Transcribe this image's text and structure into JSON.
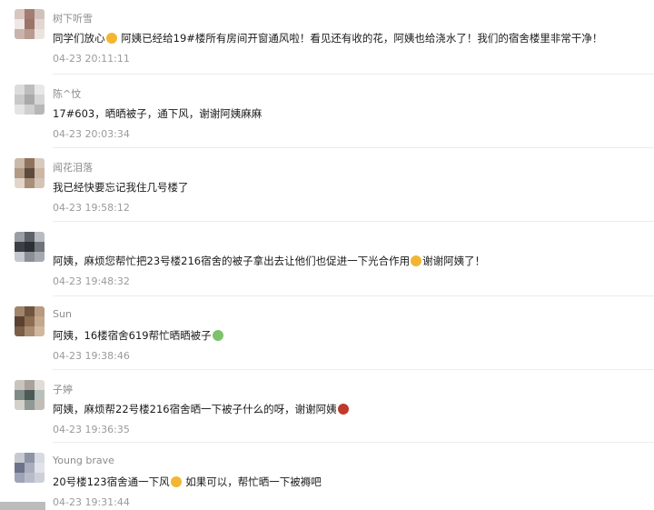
{
  "comments": [
    {
      "name": "树下听雪",
      "text_before": "同学们放心",
      "emoji": "smile-emoji",
      "text_after": " 阿姨已经给19#楼所有房间开窗通风啦！看见还有收的花，阿姨也给浇水了！我们的宿舍楼里非常干净！",
      "time": "04-23 20:11:11",
      "avatar_colors": [
        "#d8c6c0",
        "#a47c70",
        "#cfc2bd",
        "#efe8e5",
        "#9b7468",
        "#e3d6d0",
        "#c8b4ad",
        "#b99a90",
        "#ebe3df"
      ]
    },
    {
      "name": "陈^忟",
      "text_before": "17#603，晒晒被子，通下风，谢谢阿姨麻麻",
      "emoji": "",
      "text_after": "",
      "time": "04-23 20:03:34",
      "avatar_colors": [
        "#dcdcdc",
        "#bdbdbd",
        "#e8e8e8",
        "#c9c9c9",
        "#a9a9a9",
        "#d6d6d6",
        "#e4e4e4",
        "#cfcfcf",
        "#b7b7b7"
      ]
    },
    {
      "name": "闻花泪落",
      "text_before": "我已经快要忘记我住几号楼了",
      "emoji": "",
      "text_after": "",
      "time": "04-23 19:58:12",
      "avatar_colors": [
        "#c9b9a8",
        "#8f735d",
        "#d8cabc",
        "#b29a86",
        "#5e4a3c",
        "#cbb7a4",
        "#e2d6cb",
        "#a88f79",
        "#d3c4b5"
      ]
    },
    {
      "name": "",
      "text_before": "阿姨，麻烦您帮忙把23号楼216宿舍的被子拿出去让他们也促进一下光合作用",
      "emoji": "grin-emoji",
      "text_after": "谢谢阿姨了！",
      "time": "04-23 19:48:32",
      "avatar_colors": [
        "#9a9ea4",
        "#5d6168",
        "#b8bcc2",
        "#3b3f46",
        "#2c3036",
        "#6f747b",
        "#c5c8cc",
        "#8a8f96",
        "#a6aab0"
      ]
    },
    {
      "name": "Sun",
      "text_before": "阿姨，16楼宿舍619帮忙晒晒被子",
      "emoji": "frog-emoji",
      "text_after": "",
      "time": "04-23 19:38:46",
      "avatar_colors": [
        "#a0846c",
        "#6f543f",
        "#b89a80",
        "#5b4230",
        "#8c6c53",
        "#c4a88e",
        "#7a5e48",
        "#a98b71",
        "#d1b79e"
      ]
    },
    {
      "name": "子婷",
      "text_before": "阿姨，麻烦帮22号楼216宿舍晒一下被子什么的呀，谢谢阿姨",
      "emoji": "rose-emoji",
      "text_after": "",
      "time": "04-23 19:36:35",
      "avatar_colors": [
        "#c9c4bd",
        "#a9a29a",
        "#e0dcd7",
        "#7f8a86",
        "#4c5a57",
        "#b8c0bc",
        "#d4d0ca",
        "#8e9894",
        "#c2bdb6"
      ]
    },
    {
      "name": "Young brave",
      "text_before": "20号楼123宿舍通一下风",
      "emoji": "laugh-emoji",
      "text_after": " 如果可以，帮忙晒一下被褥吧",
      "time": "04-23 19:31:44",
      "avatar_colors": [
        "#c7c9d2",
        "#8e93a6",
        "#d8dae2",
        "#6c728a",
        "#a9adbd",
        "#e1e3ea",
        "#9ea3b5",
        "#b8bbca",
        "#cdd0da"
      ]
    }
  ],
  "emoji_colors": {
    "smile-emoji": "#f2b632",
    "grin-emoji": "#f2b632",
    "frog-emoji": "#7ec26b",
    "rose-emoji": "#c0392b",
    "laugh-emoji": "#f2b632"
  }
}
